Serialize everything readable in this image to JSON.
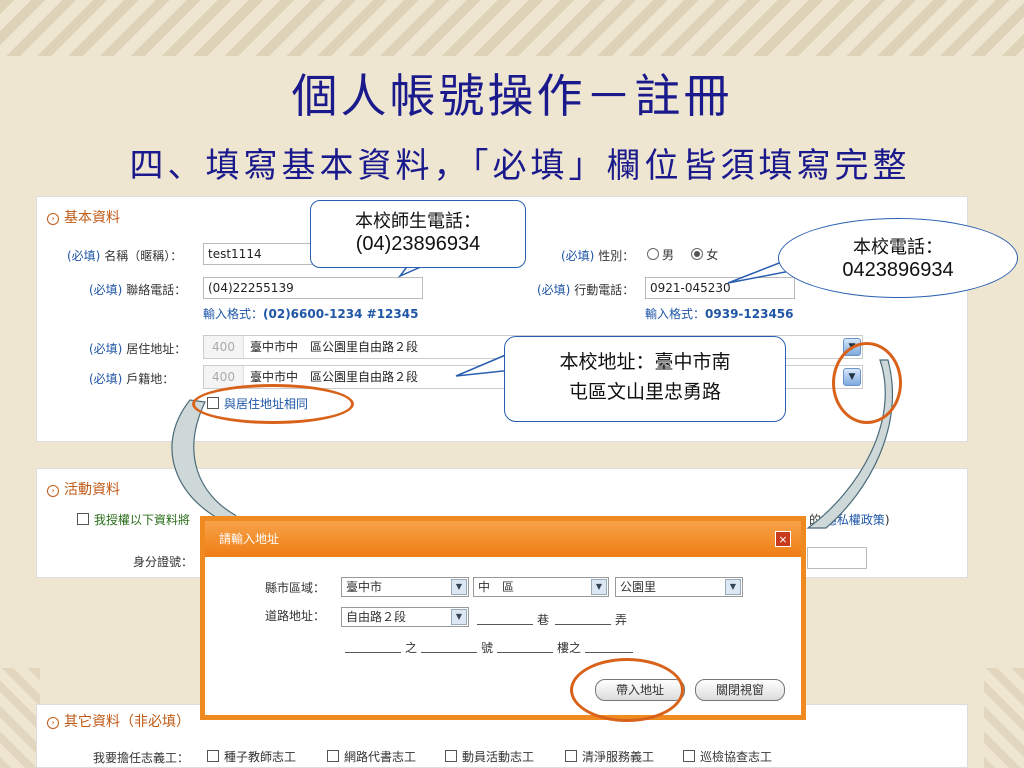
{
  "slide": {
    "title": "個人帳號操作－註冊",
    "subtitle": "四、填寫基本資料，「必填」欄位皆須填寫完整"
  },
  "basic": {
    "section_title": "基本資料",
    "required_tag": "(必填)",
    "name_label": "名稱（暱稱）：",
    "name_value": "test1114",
    "gender_label": "性別：",
    "gender_male": "男",
    "gender_female": "女",
    "gender_selected": "女",
    "phone_label": "聯絡電話：",
    "phone_value": "(04)22255139",
    "phone_hint_prefix": "輸入格式：",
    "phone_hint": "(02)6600-1234 #12345",
    "mobile_label": "行動電話：",
    "mobile_value": "0921-045230",
    "mobile_hint_prefix": "輸入格式：",
    "mobile_hint": "0939-123456",
    "res_addr_label": "居住地址：",
    "res_zip": "400",
    "res_addr": "臺中市中　區公園里自由路２段",
    "reg_addr_label": "戶籍地",
    "reg_addr_colon": "：",
    "reg_zip": "400",
    "reg_addr": "臺中市中　區公園里自由路２段",
    "same_addr_label": "與居住地址相同"
  },
  "activity": {
    "section_title": "活動資料",
    "consent_label": "我授權以下資料將",
    "privacy_tail": "的",
    "privacy_link": "隱私權政策",
    "privacy_close": ")",
    "id_label": "身分證號："
  },
  "dialog": {
    "title": "請輸入地址",
    "close": "×",
    "region_label": "縣市區域：",
    "city": "臺中市",
    "district": "中　區",
    "village": "公園里",
    "road_label": "道路地址：",
    "road": "自由路２段",
    "lane": "巷",
    "alley": "弄",
    "of": "之",
    "number": "號",
    "floor": "樓之",
    "apply_button": "帶入地址",
    "close_button": "關閉視窗"
  },
  "other": {
    "section_title": "其它資料（非必填）",
    "volunteer_label": "我要擔任志義工：",
    "options": [
      "種子教師志工",
      "網路代書志工",
      "動員活動志工",
      "清淨服務義工",
      "巡檢協查志工"
    ]
  },
  "callouts": {
    "school_phone_title": "本校師生電話：",
    "school_phone_value": "(04)23896934",
    "main_phone_title": "本校電話：",
    "main_phone_value": "0423896934",
    "address_line1": "本校地址：臺中市南",
    "address_line2": "屯區文山里忠勇路"
  },
  "colors": {
    "title_blue": "#1a1a8c",
    "accent_orange": "#ef8a20",
    "highlight_ring": "#d9621a",
    "link_blue": "#1f56a6"
  }
}
